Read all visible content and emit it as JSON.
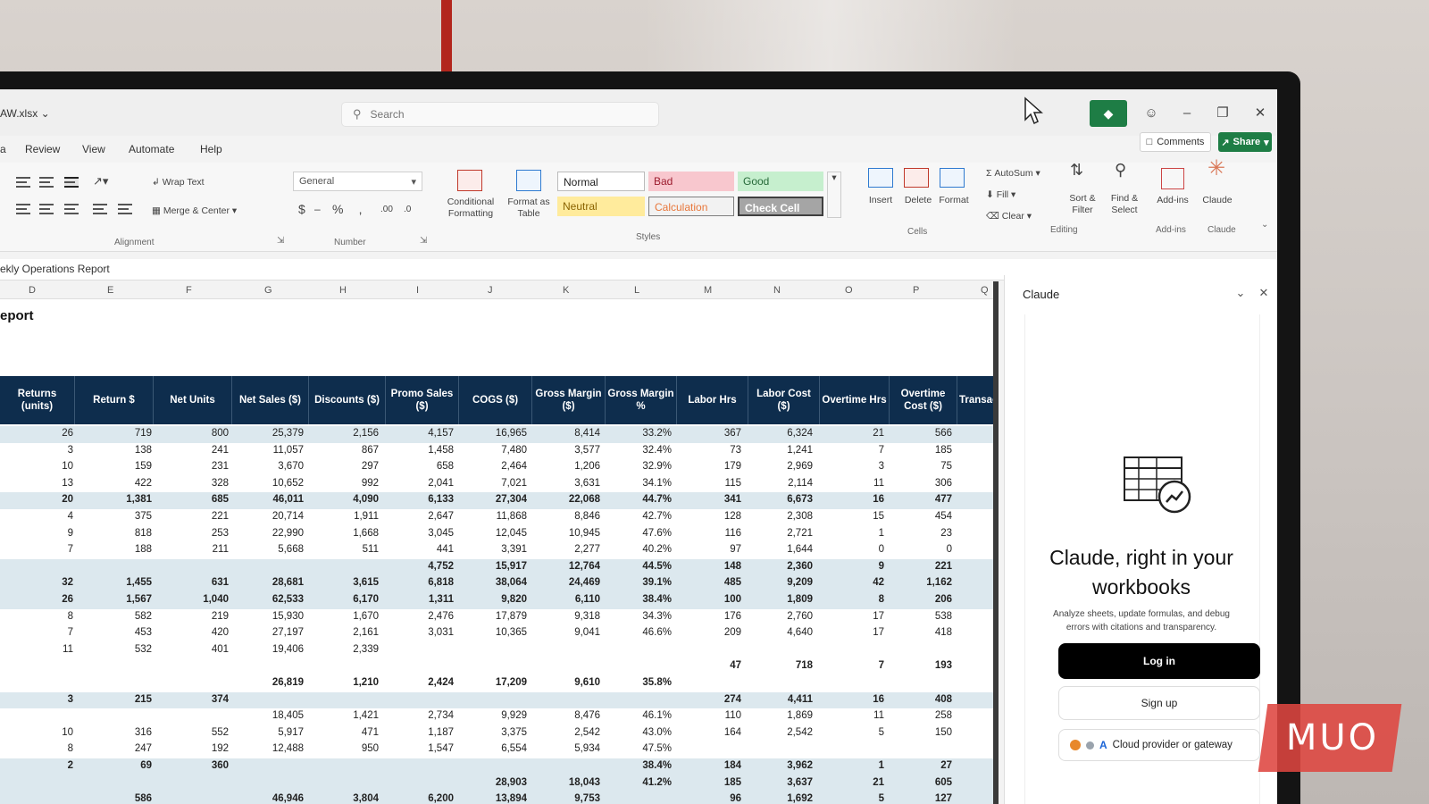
{
  "titlebar": {
    "file_name": "AW.xlsx",
    "search_placeholder": "Search"
  },
  "menu": {
    "tabs": [
      "a",
      "Review",
      "View",
      "Automate",
      "Help"
    ],
    "comments_label": "Comments",
    "share_label": "Share"
  },
  "ribbon": {
    "wrap_text": "Wrap Text",
    "merge_center": "Merge & Center",
    "alignment_label": "Alignment",
    "number_format": "General",
    "number_label": "Number",
    "conditional_formatting": "Conditional Formatting",
    "format_as_table": "Format as Table",
    "styles_label": "Styles",
    "styles": {
      "normal": "Normal",
      "bad": "Bad",
      "good": "Good",
      "neutral": "Neutral",
      "calculation": "Calculation",
      "check_cell": "Check Cell"
    },
    "insert": "Insert",
    "delete": "Delete",
    "format": "Format",
    "cells_label": "Cells",
    "autosum": "AutoSum",
    "fill": "Fill",
    "clear": "Clear",
    "sort_filter": "Sort & Filter",
    "find_select": "Find & Select",
    "editing_label": "Editing",
    "addins": "Add-ins",
    "addins_label": "Add-ins",
    "claude": "Claude",
    "claude_label": "Claude"
  },
  "formula_bar": {
    "content": "ekly Operations Report"
  },
  "sheet": {
    "columns": [
      "D",
      "E",
      "F",
      "G",
      "H",
      "I",
      "J",
      "K",
      "L",
      "M",
      "N",
      "O",
      "P",
      "Q"
    ],
    "report_title": "eport",
    "headers": [
      "Returns (units)",
      "Return $",
      "Net Units",
      "Net Sales ($)",
      "Discounts ($)",
      "Promo Sales ($)",
      "COGS ($)",
      "Gross Margin ($)",
      "Gross Margin %",
      "Labor Hrs",
      "Labor Cost ($)",
      "Overtime Hrs",
      "Overtime Cost ($)",
      "Transac"
    ],
    "rows": [
      {
        "cells": [
          "26",
          "719",
          "800",
          "25,379",
          "2,156",
          "4,157",
          "16,965",
          "8,414",
          "33.2%",
          "367",
          "6,324",
          "21",
          "566"
        ],
        "shaded": true,
        "strong": false
      },
      {
        "cells": [
          "3",
          "138",
          "241",
          "11,057",
          "867",
          "1,458",
          "7,480",
          "3,577",
          "32.4%",
          "73",
          "1,241",
          "7",
          "185"
        ],
        "shaded": false,
        "strong": false
      },
      {
        "cells": [
          "10",
          "159",
          "231",
          "3,670",
          "297",
          "658",
          "2,464",
          "1,206",
          "32.9%",
          "179",
          "2,969",
          "3",
          "75"
        ],
        "shaded": false,
        "strong": false
      },
      {
        "cells": [
          "13",
          "422",
          "328",
          "10,652",
          "992",
          "2,041",
          "7,021",
          "3,631",
          "34.1%",
          "115",
          "2,114",
          "11",
          "306"
        ],
        "shaded": false,
        "strong": false
      },
      {
        "cells": [
          "20",
          "1,381",
          "685",
          "46,011",
          "4,090",
          "6,133",
          "27,304",
          "22,068",
          "44.7%",
          "341",
          "6,673",
          "16",
          "477"
        ],
        "shaded": true,
        "strong": true
      },
      {
        "cells": [
          "4",
          "375",
          "221",
          "20,714",
          "1,911",
          "2,647",
          "11,868",
          "8,846",
          "42.7%",
          "128",
          "2,308",
          "15",
          "454"
        ],
        "shaded": false,
        "strong": false
      },
      {
        "cells": [
          "9",
          "818",
          "253",
          "22,990",
          "1,668",
          "3,045",
          "12,045",
          "10,945",
          "47.6%",
          "116",
          "2,721",
          "1",
          "23"
        ],
        "shaded": false,
        "strong": false
      },
      {
        "cells": [
          "7",
          "188",
          "211",
          "5,668",
          "511",
          "441",
          "3,391",
          "2,277",
          "40.2%",
          "97",
          "1,644",
          "0",
          "0"
        ],
        "shaded": false,
        "strong": false
      },
      {
        "cells": [
          "",
          "",
          "",
          "",
          "",
          "4,752",
          "15,917",
          "12,764",
          "44.5%",
          "148",
          "2,360",
          "9",
          "221"
        ],
        "shaded": true,
        "strong": true
      },
      {
        "cells": [
          "32",
          "1,455",
          "631",
          "28,681",
          "3,615",
          "6,818",
          "38,064",
          "24,469",
          "39.1%",
          "485",
          "9,209",
          "42",
          "1,162"
        ],
        "shaded": true,
        "strong": true
      },
      {
        "cells": [
          "26",
          "1,567",
          "1,040",
          "62,533",
          "6,170",
          "1,311",
          "9,820",
          "6,110",
          "38.4%",
          "100",
          "1,809",
          "8",
          "206"
        ],
        "shaded": true,
        "strong": true
      },
      {
        "cells": [
          "8",
          "582",
          "219",
          "15,930",
          "1,670",
          "2,476",
          "17,879",
          "9,318",
          "34.3%",
          "176",
          "2,760",
          "17",
          "538"
        ],
        "shaded": false,
        "strong": false
      },
      {
        "cells": [
          "7",
          "453",
          "420",
          "27,197",
          "2,161",
          "3,031",
          "10,365",
          "9,041",
          "46.6%",
          "209",
          "4,640",
          "17",
          "418"
        ],
        "shaded": false,
        "strong": false
      },
      {
        "cells": [
          "11",
          "532",
          "401",
          "19,406",
          "2,339",
          "",
          "",
          "",
          "",
          "",
          "",
          "",
          ""
        ],
        "shaded": false,
        "strong": false
      },
      {
        "cells": [
          "",
          "",
          "",
          "",
          "",
          "",
          "",
          "",
          "",
          "47",
          "718",
          "7",
          "193"
        ],
        "shaded": false,
        "strong": true
      },
      {
        "cells": [
          "",
          "",
          "",
          "26,819",
          "1,210",
          "2,424",
          "17,209",
          "9,610",
          "35.8%",
          "",
          "",
          "",
          ""
        ],
        "shaded": false,
        "strong": true
      },
      {
        "cells": [
          "3",
          "215",
          "374",
          "",
          "",
          "",
          "",
          "",
          "",
          "274",
          "4,411",
          "16",
          "408"
        ],
        "shaded": true,
        "strong": true
      },
      {
        "cells": [
          "",
          "",
          "",
          "18,405",
          "1,421",
          "2,734",
          "9,929",
          "8,476",
          "46.1%",
          "110",
          "1,869",
          "11",
          "258"
        ],
        "shaded": false,
        "strong": false
      },
      {
        "cells": [
          "10",
          "316",
          "552",
          "5,917",
          "471",
          "1,187",
          "3,375",
          "2,542",
          "43.0%",
          "164",
          "2,542",
          "5",
          "150"
        ],
        "shaded": false,
        "strong": false
      },
      {
        "cells": [
          "8",
          "247",
          "192",
          "12,488",
          "950",
          "1,547",
          "6,554",
          "5,934",
          "47.5%",
          "",
          "",
          "",
          ""
        ],
        "shaded": false,
        "strong": false
      },
      {
        "cells": [
          "2",
          "69",
          "360",
          "",
          "",
          "",
          "",
          "",
          "38.4%",
          "184",
          "3,962",
          "1",
          "27"
        ],
        "shaded": true,
        "strong": true
      },
      {
        "cells": [
          "",
          "",
          "",
          "",
          "",
          "",
          "28,903",
          "18,043",
          "41.2%",
          "185",
          "3,637",
          "21",
          "605"
        ],
        "shaded": true,
        "strong": true
      },
      {
        "cells": [
          "",
          "586",
          "",
          "46,946",
          "3,804",
          "6,200",
          "13,894",
          "9,753",
          "",
          "96",
          "1,692",
          "5",
          "127"
        ],
        "shaded": true,
        "strong": true
      }
    ]
  },
  "pane": {
    "title": "Claude",
    "headline": "Claude, right in your workbooks",
    "description": "Analyze sheets, update formulas, and debug errors with citations and transparency.",
    "login_label": "Log in",
    "signup_label": "Sign up",
    "cloud_label": "Cloud provider or gateway"
  },
  "watermark": {
    "text": "MUO"
  },
  "colors": {
    "header_fill": "#0e2d4d",
    "shaded_row": "#dce8ee",
    "excel_green": "#1e7d45",
    "style_bad": "#f8c7ce",
    "style_good": "#c6efce",
    "style_neutral": "#ffeb9c"
  }
}
